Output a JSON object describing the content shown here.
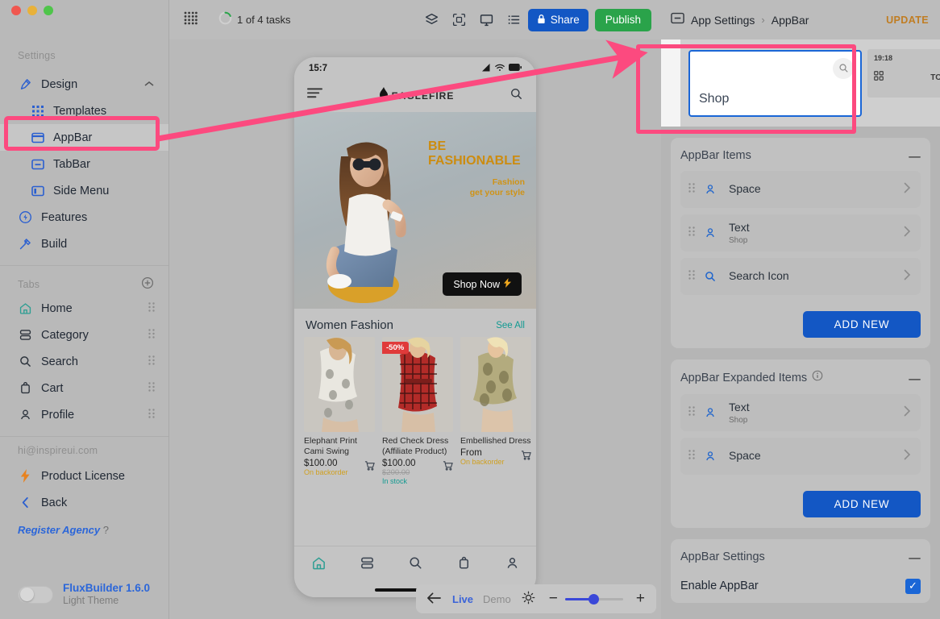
{
  "sidebar": {
    "settings_label": "Settings",
    "design": {
      "label": "Design",
      "icon": "design-pen-icon"
    },
    "design_children": [
      {
        "label": "Templates",
        "icon": "templates-grid-icon"
      },
      {
        "label": "AppBar",
        "icon": "appbar-icon",
        "selected": true
      },
      {
        "label": "TabBar",
        "icon": "tabbar-icon"
      },
      {
        "label": "Side Menu",
        "icon": "sidemenu-icon"
      }
    ],
    "features": {
      "label": "Features",
      "icon": "features-bolt-circle-icon"
    },
    "build": {
      "label": "Build",
      "icon": "build-hammer-icon"
    },
    "tabs_label": "Tabs",
    "tabs_add_icon": "plus-circle-icon",
    "tabs": [
      {
        "label": "Home",
        "icon": "home-icon"
      },
      {
        "label": "Category",
        "icon": "category-icon"
      },
      {
        "label": "Search",
        "icon": "search-icon"
      },
      {
        "label": "Cart",
        "icon": "cart-bag-icon"
      },
      {
        "label": "Profile",
        "icon": "profile-person-icon"
      }
    ],
    "account_email": "hi@inspireui.com",
    "product_license": "Product License",
    "back": "Back",
    "register_agency": "Register Agency",
    "register_agency_help": "?",
    "version": "FluxBuilder 1.6.0",
    "theme": "Light Theme"
  },
  "topbar": {
    "apps_icon": "apps-grid-icon",
    "tasks": "1 of 4 tasks",
    "icons": [
      "layers-icon",
      "qr-scan-icon",
      "monitor-icon",
      "list-icon"
    ],
    "share_label": "Share",
    "share_icon": "lock-icon",
    "publish_label": "Publish"
  },
  "canvas": {
    "phone": {
      "status_time": "15:7",
      "status_icons": [
        "signal-icon",
        "wifi-icon",
        "battery-icon"
      ],
      "menu_icon": "hamburger-icon",
      "brand": "EAGLEFIRE",
      "brand_icon": "flame-logo-icon",
      "search_icon": "search-icon",
      "hero": {
        "line1": "BE",
        "line2": "FASHIONABLE",
        "sub1": "Fashion",
        "sub2": "get your style",
        "cta": "Shop Now",
        "cta_icon": "bolt-icon"
      },
      "section": {
        "title": "Women Fashion",
        "see_all": "See All"
      },
      "products": [
        {
          "name": "Elephant Print Cami Swing",
          "price": "$100.00",
          "old_price": "",
          "stock": "On backorder",
          "stock_type": "backorder",
          "badge": "",
          "cart_icon": "cart-add-icon"
        },
        {
          "name": "Red Check Dress (Affiliate Product)",
          "price": "$100.00",
          "old_price": "$200.00",
          "stock": "In stock",
          "stock_type": "instock",
          "badge": "-50%",
          "cart_icon": "cart-add-icon"
        },
        {
          "name": "Embellished Dress",
          "price": "From",
          "old_price": "",
          "stock": "On backorder",
          "stock_type": "backorder",
          "badge": "",
          "cart_icon": "cart-add-icon"
        }
      ],
      "nav_icons": [
        "home-icon",
        "category-icon",
        "search-icon",
        "cart-bag-icon",
        "profile-person-icon"
      ]
    },
    "preview_toolbar": {
      "back_icon": "arrow-left-icon",
      "live": "Live",
      "demo": "Demo",
      "brightness_icon": "sun-icon",
      "minus": "−",
      "plus": "+",
      "zoom_percent": 45
    }
  },
  "right_panel": {
    "breadcrumb_icon": "panel-icon",
    "breadcrumb_root": "App Settings",
    "breadcrumb_sep": "›",
    "breadcrumb_current": "AppBar",
    "update_label": "UPDATE",
    "preview": {
      "shop_label": "Shop",
      "search_icon": "search-icon",
      "mini_time": "19:18",
      "mini_grid_icon": "grid-icon",
      "mini_label": "TO"
    },
    "appbar_items": {
      "title": "AppBar Items",
      "collapse_icon": "minus-icon",
      "items": [
        {
          "label": "Space",
          "sub": "",
          "icon": "person-icon",
          "grip": "drag-handle-icon",
          "arrow": "chevron-right-icon"
        },
        {
          "label": "Text",
          "sub": "Shop",
          "icon": "person-icon",
          "grip": "drag-handle-icon",
          "arrow": "chevron-right-icon"
        },
        {
          "label": "Search Icon",
          "sub": "",
          "icon": "search-icon",
          "grip": "drag-handle-icon",
          "arrow": "chevron-right-icon"
        }
      ],
      "add_new": "ADD NEW"
    },
    "appbar_expanded_items": {
      "title": "AppBar Expanded Items",
      "info_icon": "info-icon",
      "collapse_icon": "minus-icon",
      "items": [
        {
          "label": "Text",
          "sub": "Shop",
          "icon": "person-icon",
          "grip": "drag-handle-icon",
          "arrow": "chevron-right-icon"
        },
        {
          "label": "Space",
          "sub": "",
          "icon": "person-icon",
          "grip": "drag-handle-icon",
          "arrow": "chevron-right-icon"
        }
      ],
      "add_new": "ADD NEW"
    },
    "appbar_settings": {
      "title": "AppBar Settings",
      "collapse_icon": "minus-icon",
      "enable_label": "Enable AppBar",
      "enable_checked": true,
      "check_glyph": "✓"
    }
  },
  "annotation": {
    "color": "#fc4a7f",
    "highlight_1": "appbar-sidebar-item",
    "highlight_2": "shop-appbar-preview",
    "arrow": "appbar-to-shop-preview"
  }
}
